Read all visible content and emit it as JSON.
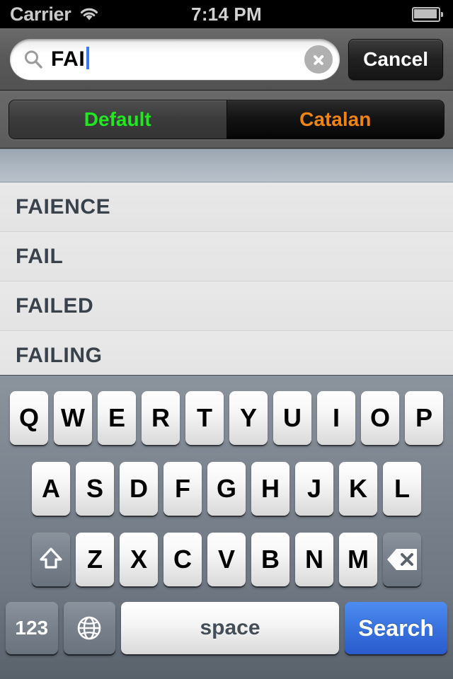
{
  "status_bar": {
    "carrier": "Carrier",
    "time": "7:14 PM",
    "wifi_icon": "wifi-icon",
    "battery_icon": "battery-full-icon"
  },
  "search_bar": {
    "magnifier_icon": "search-icon",
    "value": "FAI",
    "placeholder": "Search",
    "clear_icon": "clear-circle-icon",
    "cancel_label": "Cancel"
  },
  "scope_bar": {
    "selected_index": 0,
    "segments": [
      {
        "label": "Default",
        "color": "#1fe81f",
        "selected": true
      },
      {
        "label": "Catalan",
        "color": "#f08413",
        "selected": false
      }
    ]
  },
  "results": {
    "section_header": "",
    "items": [
      {
        "label": "FAIENCE"
      },
      {
        "label": "FAIL"
      },
      {
        "label": "FAILED"
      },
      {
        "label": "FAILING"
      }
    ]
  },
  "keyboard": {
    "row1": [
      "Q",
      "W",
      "E",
      "R",
      "T",
      "Y",
      "U",
      "I",
      "O",
      "P"
    ],
    "row2": [
      "A",
      "S",
      "D",
      "F",
      "G",
      "H",
      "J",
      "K",
      "L"
    ],
    "row3": [
      "Z",
      "X",
      "C",
      "V",
      "B",
      "N",
      "M"
    ],
    "shift_icon": "shift-arrow-icon",
    "delete_icon": "backspace-icon",
    "numbers_label": "123",
    "globe_icon": "globe-icon",
    "space_label": "space",
    "search_label": "Search"
  },
  "colors": {
    "accent_green": "#1fe81f",
    "accent_orange": "#f08413",
    "search_button_blue": "#3a75e0",
    "caret_blue": "#3a7bf0"
  }
}
